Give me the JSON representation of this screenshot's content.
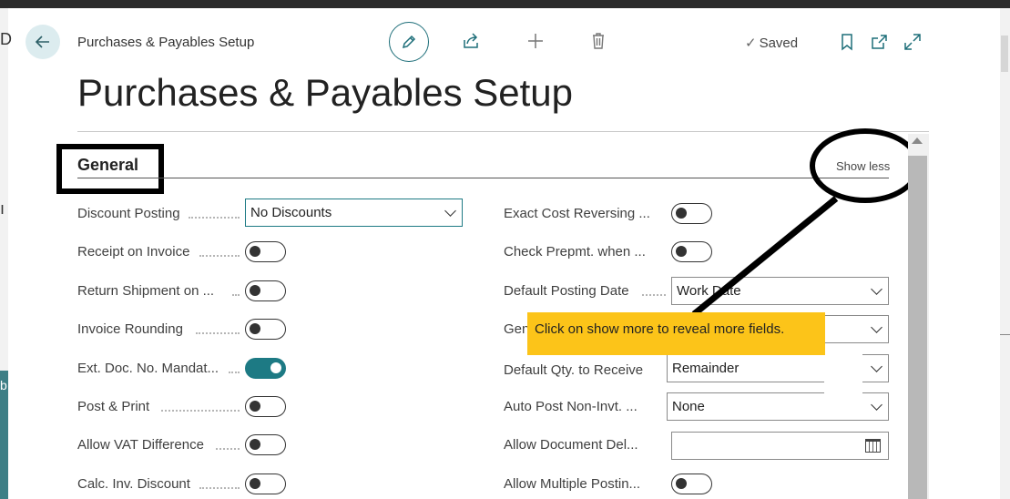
{
  "header": {
    "breadcrumb": "Purchases & Payables Setup",
    "status": "Saved",
    "page_title": "Purchases & Payables Setup"
  },
  "backdrop": {
    "left_fragment_1": "D",
    "left_fragment_2": "ı",
    "left_fragment_3": "b"
  },
  "section": {
    "title": "General",
    "toggle_link": "Show less"
  },
  "callout": {
    "text": "Click on show more to reveal more fields."
  },
  "left_fields": [
    {
      "label": "Discount Posting",
      "type": "select",
      "value": "No Discounts"
    },
    {
      "label": "Receipt on Invoice",
      "type": "toggle",
      "on": false
    },
    {
      "label": "Return Shipment on ...",
      "type": "toggle",
      "on": false
    },
    {
      "label": "Invoice Rounding",
      "type": "toggle",
      "on": false
    },
    {
      "label": "Ext. Doc. No. Mandat...",
      "type": "toggle",
      "on": true
    },
    {
      "label": "Post & Print",
      "type": "toggle",
      "on": false
    },
    {
      "label": "Allow VAT Difference",
      "type": "toggle",
      "on": false
    },
    {
      "label": "Calc. Inv. Discount",
      "type": "toggle",
      "on": false
    }
  ],
  "right_fields": [
    {
      "label": "Exact Cost Reversing ...",
      "type": "toggle",
      "on": false
    },
    {
      "label": "Check Prepmt. when ...",
      "type": "toggle",
      "on": false
    },
    {
      "label": "Default Posting Date",
      "type": "select",
      "value": "Work Date"
    },
    {
      "label": "Gen",
      "type": "select",
      "value": ""
    },
    {
      "label": "Default Qty. to Receive",
      "type": "select",
      "value": "Remainder"
    },
    {
      "label": "Auto Post Non-Invt. ...",
      "type": "select",
      "value": "None"
    },
    {
      "label": "Allow Document Del...",
      "type": "date",
      "value": ""
    },
    {
      "label": "Allow Multiple Postin...",
      "type": "toggle",
      "on": false
    }
  ],
  "icons": {
    "back": "arrow-left-icon",
    "edit": "pencil-icon",
    "share": "share-icon",
    "new": "plus-icon",
    "delete": "trash-icon",
    "bookmark": "bookmark-icon",
    "open_new_window": "open-external-icon",
    "expand": "expand-icon"
  },
  "colors": {
    "accent": "#1d7a84",
    "callout": "#fcc419"
  }
}
